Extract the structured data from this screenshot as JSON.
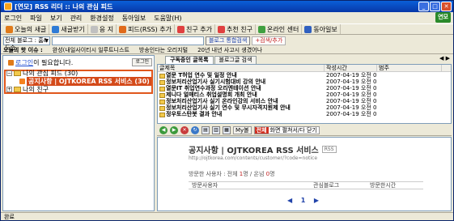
{
  "window": {
    "title": "[연모] RSS 리더 :: 나의 관심 피드",
    "logo": "연모"
  },
  "menu": [
    "로그인",
    "파일",
    "보기",
    "관리",
    "환경설정",
    "동아일보",
    "도움말(H)"
  ],
  "toolbar": [
    {
      "label": "오늘의 새글",
      "color": "#e07a1a"
    },
    {
      "label": "새글받기",
      "color": "#2e7bd6"
    },
    {
      "label": "응 지",
      "color": "#c0c0c0"
    },
    {
      "label": "피드(RSS) 추가",
      "color": "#e06a1a"
    },
    {
      "label": "친구 추가",
      "color": "#e04040"
    },
    {
      "label": "추천 친구",
      "color": "#e04040"
    },
    {
      "label": "온라인 센터",
      "color": "#40a040"
    },
    {
      "label": "동아일보",
      "color": "#3060c0"
    }
  ],
  "search": {
    "scope": "전체 블로그 : 홈&도순",
    "query": "",
    "search_button": "블로그 통합검색",
    "quick_button": "+검색/추가"
  },
  "issues": {
    "label": "오늘의 핫 이슈 :",
    "items": [
      "완성(내일사이티시 일루트니스트",
      "방송인다는 오리지털",
      "20년 내년 사고시 생겼어나"
    ]
  },
  "left": {
    "login_link": "로그인",
    "login_text": "이 필요합니다.",
    "login_button": "로그인",
    "tree": [
      {
        "label": "나의 관심 피드 (30)",
        "type": "folder"
      },
      {
        "label": "공지사항 | OJTKOREA RSS 서비스 (30)",
        "type": "feed",
        "selected": true
      },
      {
        "label": "나의 친구",
        "type": "folder"
      }
    ]
  },
  "tabs": [
    "구독중인 글목록",
    "블로그글 검색"
  ],
  "tab_arrows": "◀ ▶",
  "list": {
    "headers": [
      "글제목",
      "작성시간",
      "범주"
    ],
    "rows": [
      {
        "title": "열문 T허업 연수 및 일정 안내",
        "date": "2007-04-19 오전 0...",
        "cat": ""
      },
      {
        "title": "정보처리산업기사 실기시험대비 강의 안내",
        "date": "2007-04-19 오전 0...",
        "cat": ""
      },
      {
        "title": "열문IT 취업연수과정 오리엔테이션 안내",
        "date": "2007-04-19 오전 0...",
        "cat": ""
      },
      {
        "title": "제니다 얼매티스 취업설명회 개최 안내",
        "date": "2007-04-19 오전 0...",
        "cat": ""
      },
      {
        "title": "정보처리산업기사 실기 온라인강의 서비스 안내",
        "date": "2007-04-19 오전 0...",
        "cat": ""
      },
      {
        "title": "정보처리산업기사 실기 연수 및 무시자격지원제 안내",
        "date": "2007-04-19 오전 0...",
        "cat": ""
      },
      {
        "title": "정우토스탄봇 결과 안내",
        "date": "2007-04-19 오전 0...",
        "cat": ""
      }
    ]
  },
  "viewer_toolbar": {
    "nav": [
      "◀",
      "▶",
      "✕",
      "↻"
    ],
    "tools": [
      "▤",
      "▥",
      "▦"
    ],
    "mylist": "My볼",
    "full_badge": "전체",
    "full_text": "화면 펼쳐서/다 닫기"
  },
  "viewer": {
    "title": "공지사항 | OJTKOREA RSS 서비스",
    "rss": "RSS",
    "url": "http://ojtkorea.com/contents/customer/?code=notice",
    "visitors_prefix": "방문한 사용자 : 전체",
    "visitors_total": "1",
    "visitors_mid": "명 / 온넘",
    "visitors_today": "0",
    "visitors_suffix": "명",
    "table_headers": [
      "방문사용자",
      "관심블로그",
      "방문한시간"
    ],
    "pager_prev": "◀",
    "pager_current": "1",
    "pager_next": "▶"
  },
  "status": "완료"
}
